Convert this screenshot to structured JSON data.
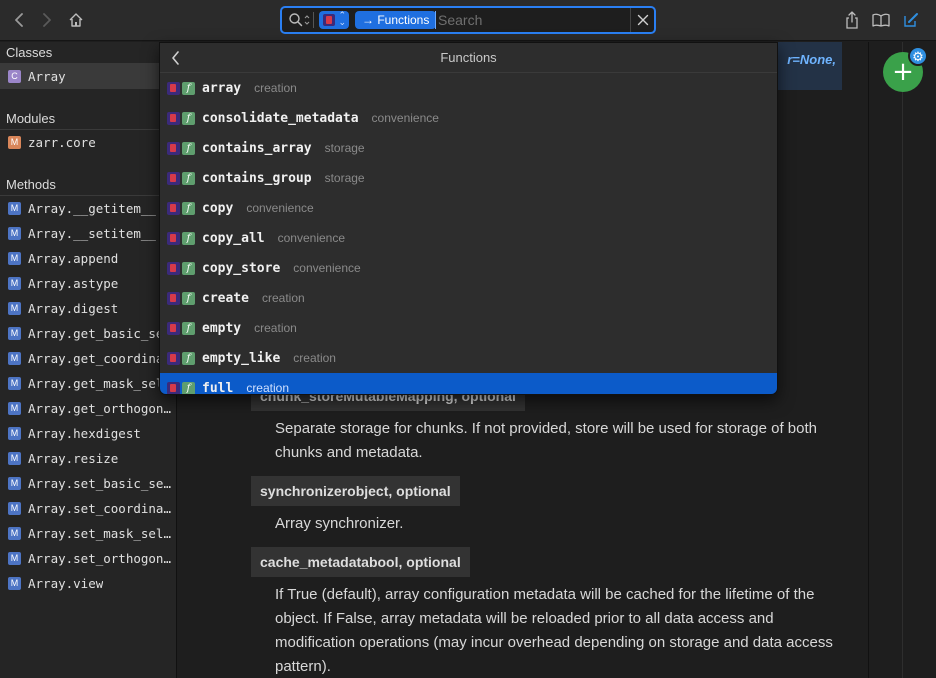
{
  "toolbar": {
    "search": {
      "docset_chevron": "⌃⌄",
      "token_label": "→ Functions",
      "placeholder": "Search",
      "value": ""
    }
  },
  "sidebar": {
    "classes_header": "Classes",
    "classes": [
      {
        "badge": "C",
        "label": "Array"
      }
    ],
    "modules_header": "Modules",
    "modules": [
      {
        "badge": "M",
        "label": "zarr.core"
      }
    ],
    "methods_header": "Methods",
    "methods": [
      {
        "badge": "M",
        "label": "Array.__getitem__"
      },
      {
        "badge": "M",
        "label": "Array.__setitem__"
      },
      {
        "badge": "M",
        "label": "Array.append"
      },
      {
        "badge": "M",
        "label": "Array.astype"
      },
      {
        "badge": "M",
        "label": "Array.digest"
      },
      {
        "badge": "M",
        "label": "Array.get_basic_selection"
      },
      {
        "badge": "M",
        "label": "Array.get_coordinate_selection"
      },
      {
        "badge": "M",
        "label": "Array.get_mask_selection"
      },
      {
        "badge": "M",
        "label": "Array.get_orthogonal_selection"
      },
      {
        "badge": "M",
        "label": "Array.hexdigest"
      },
      {
        "badge": "M",
        "label": "Array.resize"
      },
      {
        "badge": "M",
        "label": "Array.set_basic_selection"
      },
      {
        "badge": "M",
        "label": "Array.set_coordinate_selection"
      },
      {
        "badge": "M",
        "label": "Array.set_mask_selection"
      },
      {
        "badge": "M",
        "label": "Array.set_orthogonal_selection"
      },
      {
        "badge": "M",
        "label": "Array.view"
      }
    ]
  },
  "dropdown": {
    "title": "Functions",
    "items": [
      {
        "name": "array",
        "tag": "creation"
      },
      {
        "name": "consolidate_metadata",
        "tag": "convenience"
      },
      {
        "name": "contains_array",
        "tag": "storage"
      },
      {
        "name": "contains_group",
        "tag": "storage"
      },
      {
        "name": "copy",
        "tag": "convenience"
      },
      {
        "name": "copy_all",
        "tag": "convenience"
      },
      {
        "name": "copy_store",
        "tag": "convenience"
      },
      {
        "name": "create",
        "tag": "creation"
      },
      {
        "name": "empty",
        "tag": "creation"
      },
      {
        "name": "empty_like",
        "tag": "creation"
      },
      {
        "name": "full",
        "tag": "creation"
      }
    ],
    "selected_index": 10
  },
  "main": {
    "signature_tail": "r=None,",
    "params": [
      {
        "name": "chunk_storeMutableMapping, optional",
        "desc": "Separate storage for chunks. If not provided, store will be used for storage of both chunks and metadata."
      },
      {
        "name": "synchronizerobject, optional",
        "desc": "Array synchronizer."
      },
      {
        "name": "cache_metadatabool, optional",
        "desc": "If True (default), array configuration metadata will be cached for the lifetime of the object. If False, array metadata will be reloaded prior to all data access and modification operations (may incur overhead depending on storage and data access pattern)."
      }
    ]
  },
  "rightbar": {
    "fab_label": "+",
    "gear_glyph": "⚙"
  },
  "colors": {
    "accent": "#2a7ff3",
    "selection": "#0c5bc9",
    "fab": "#3aa14a"
  }
}
